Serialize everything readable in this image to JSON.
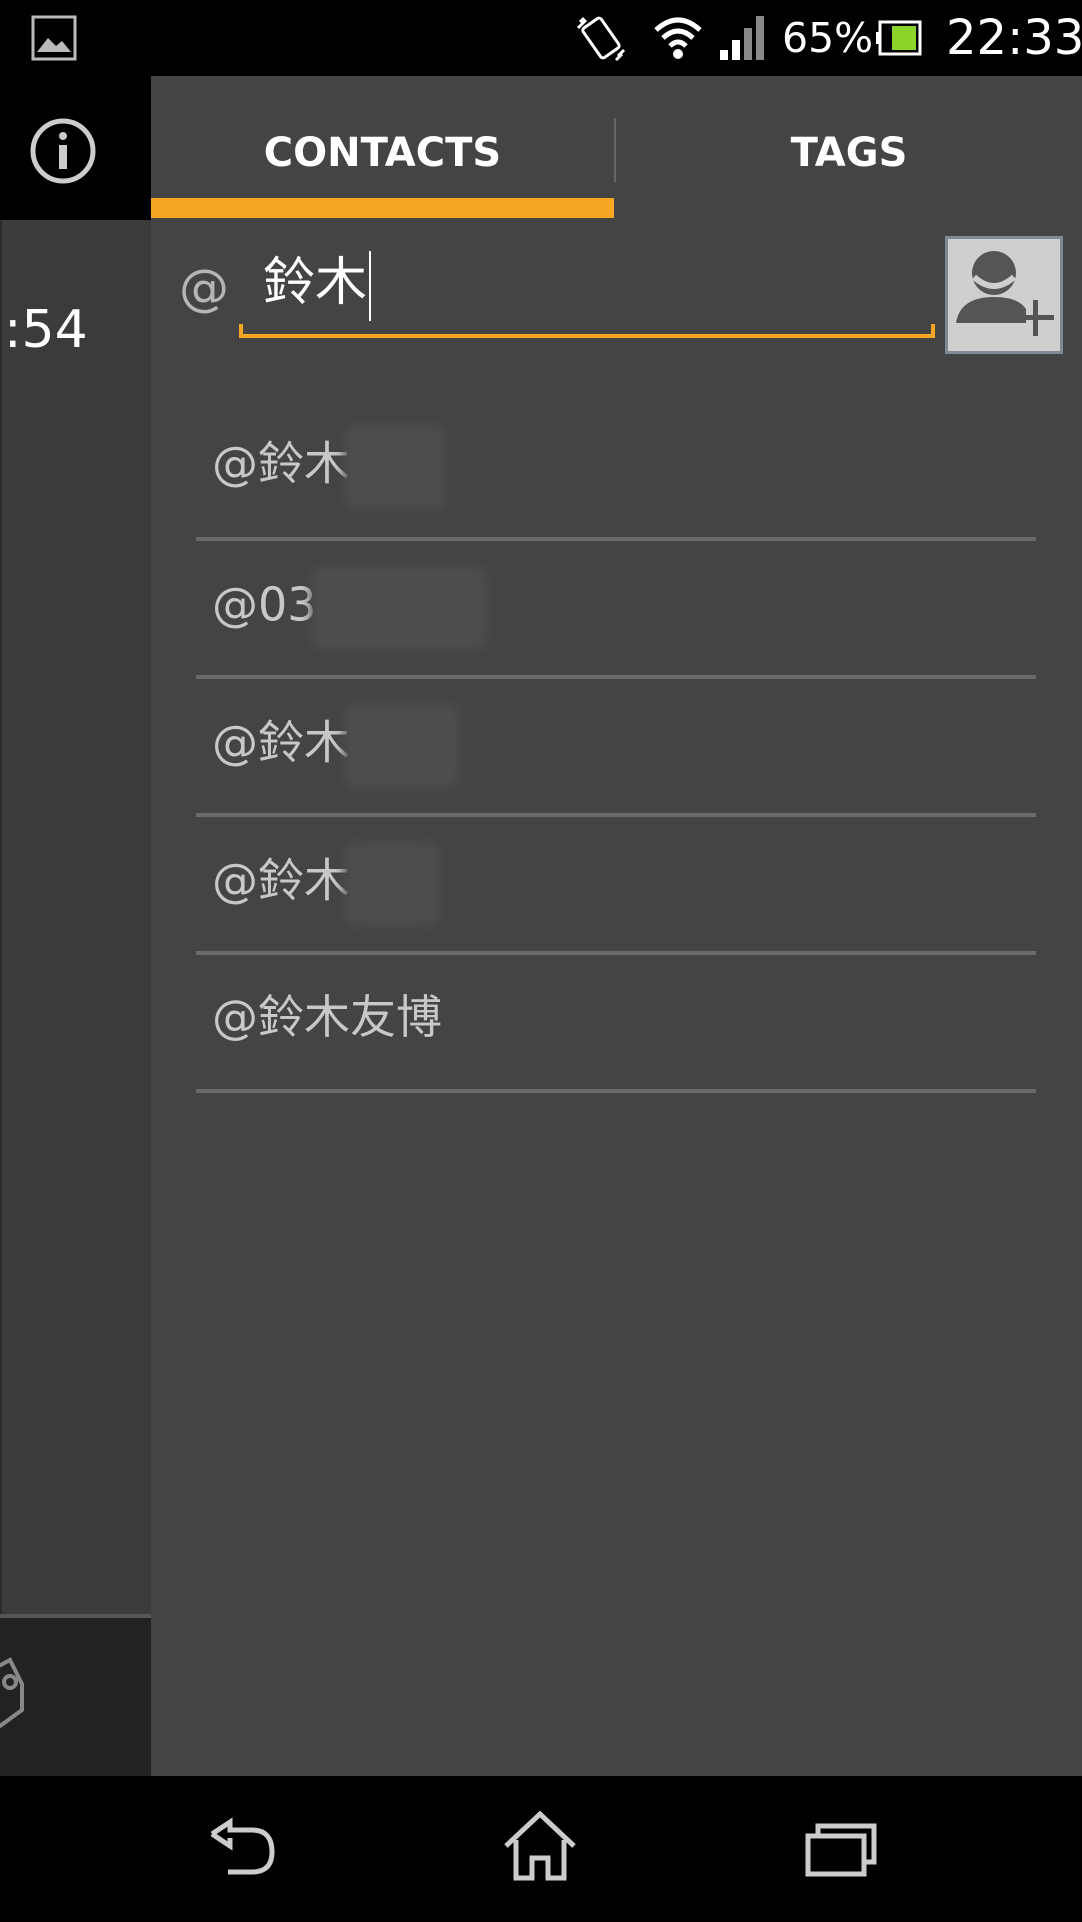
{
  "status_bar": {
    "battery_percent": "65%",
    "time": "22:33",
    "icons": [
      "gallery-icon",
      "vibrate-icon",
      "wifi-icon",
      "signal-icon",
      "battery-icon"
    ]
  },
  "background_app": {
    "partial_time": ":54",
    "icons": [
      "info-icon",
      "tag-icon"
    ]
  },
  "tabs": [
    {
      "label": "CONTACTS",
      "selected": true
    },
    {
      "label": "TAGS",
      "selected": false
    }
  ],
  "search": {
    "prefix": "@",
    "value": "鈴木"
  },
  "add_contact_icon": "add-contact-icon",
  "suggestions": [
    {
      "label": "@鈴木",
      "redacted": true
    },
    {
      "label": "@03",
      "redacted": true
    },
    {
      "label": "@鈴木",
      "redacted": true
    },
    {
      "label": "@鈴木",
      "redacted": true
    },
    {
      "label": "@鈴木友博",
      "redacted": false
    }
  ],
  "nav": {
    "icons": [
      "back-icon",
      "home-icon",
      "recents-icon"
    ]
  },
  "colors": {
    "accent": "#f5a623",
    "panel": "#444444",
    "background": "#000000"
  }
}
